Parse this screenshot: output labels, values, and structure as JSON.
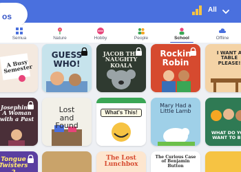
{
  "header": {
    "logo_text": "os",
    "filter_label": "All"
  },
  "categories": [
    {
      "label": "Semua",
      "icon": "grid-icon"
    },
    {
      "label": "Nature",
      "icon": "flower-icon"
    },
    {
      "label": "Hobby",
      "icon": "ball-icon"
    },
    {
      "label": "People",
      "icon": "people-icon"
    },
    {
      "label": "School",
      "icon": "school-icon",
      "active": true
    },
    {
      "label": "Offline",
      "icon": "cloud-icon"
    }
  ],
  "books": [
    {
      "title": "A Busy Semester"
    },
    {
      "title": "GUESS WHO!"
    },
    {
      "title": "JACOB THE NAUGHTY KOALA"
    },
    {
      "title": "Rockin Robin"
    },
    {
      "title": "I WANT A TABLE PLEASE!"
    },
    {
      "title": "Josephine: A Woman with a Past"
    },
    {
      "title": "Lost and Found"
    },
    {
      "title": "What's This!"
    },
    {
      "title": "Mary Had a Little Lamb"
    },
    {
      "title": "WHAT DO YOU WANT TO BE?"
    },
    {
      "title": "Tongue Twisters 2"
    },
    {
      "title": "The Lost Lunchbox"
    },
    {
      "title": "The Curious Case of Benjamin Button"
    }
  ],
  "colors": {
    "topbar": "#4a70de",
    "accent": "#3756c7"
  }
}
